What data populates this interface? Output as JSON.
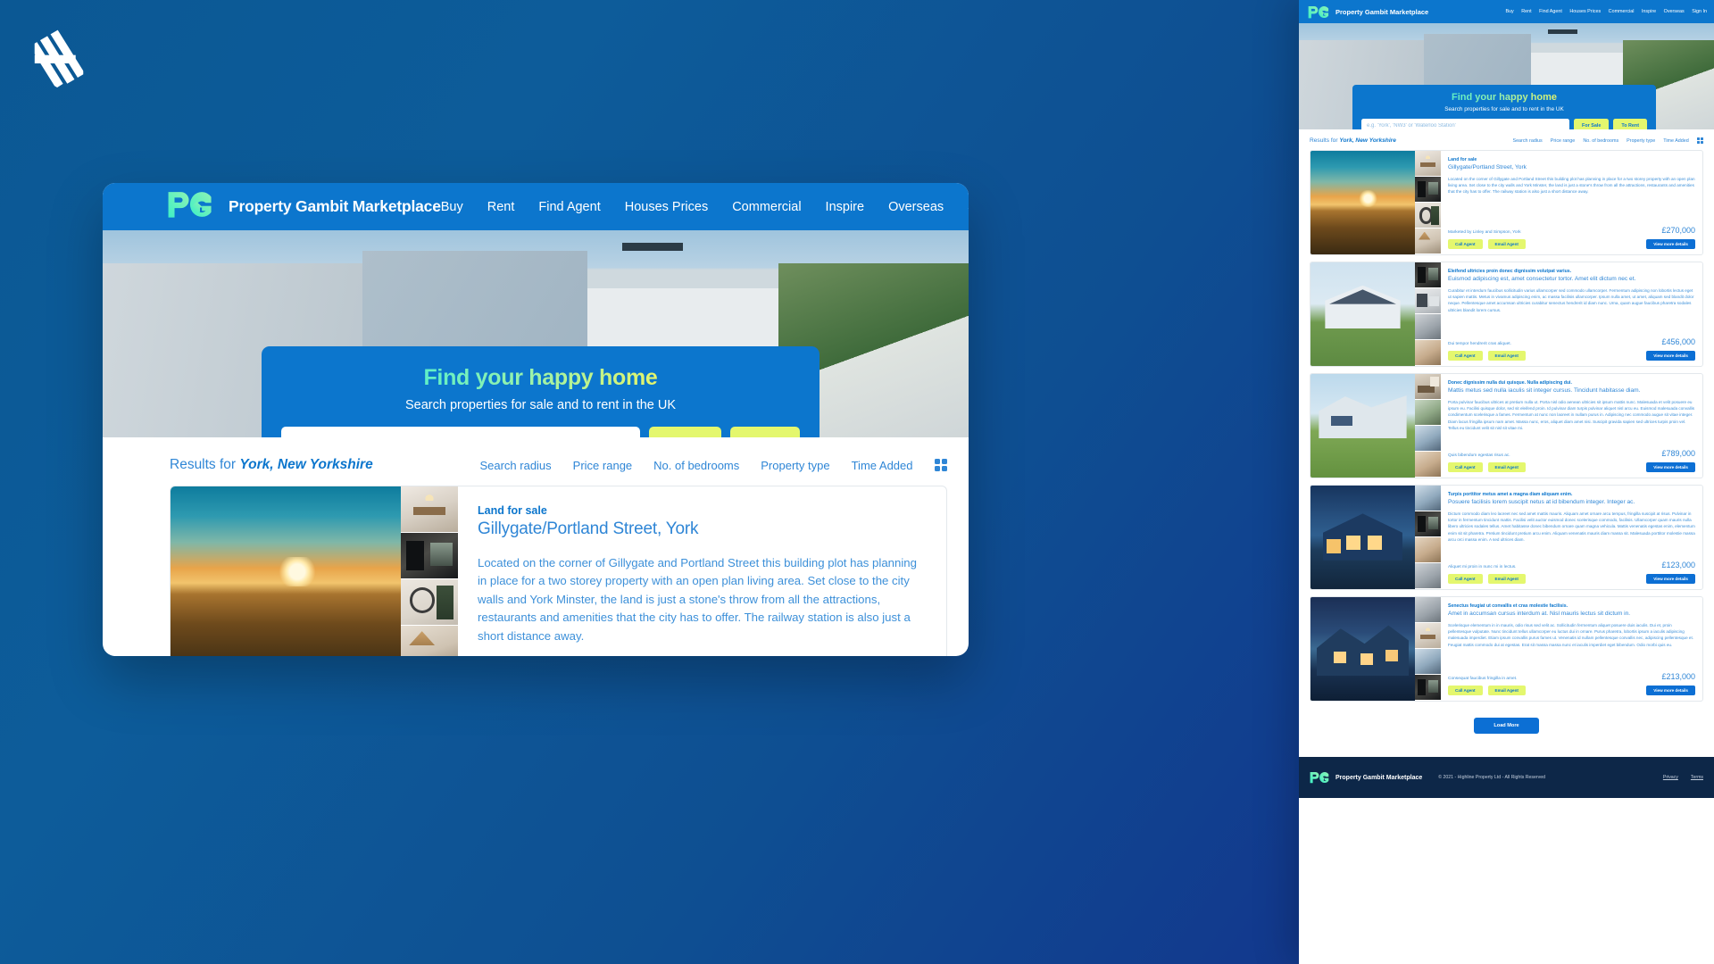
{
  "brand": {
    "logo_icon": "pg-house-logo",
    "name": "Property Gambit Marketplace",
    "highline_logo_icon": "highline-hl-logo"
  },
  "nav": {
    "items": [
      {
        "label": "Buy"
      },
      {
        "label": "Rent"
      },
      {
        "label": "Find Agent"
      },
      {
        "label": "Houses Prices"
      },
      {
        "label": "Commercial"
      },
      {
        "label": "Inspire"
      },
      {
        "label": "Overseas"
      },
      {
        "label": "Sign In"
      }
    ]
  },
  "hero": {
    "title": "Find your happy home",
    "subtitle": "Search properties for sale and to rent in the UK",
    "search_placeholder": "e.g. 'York', 'NW3' or 'Waterloo Station'",
    "search_value": "",
    "for_sale_label": "For Sale",
    "to_rent_label": "To Rent"
  },
  "results": {
    "prefix": "Results for ",
    "location": "York, New Yorkshire",
    "filters": [
      {
        "label": "Search radius"
      },
      {
        "label": "Price range"
      },
      {
        "label": "No. of bedrooms"
      },
      {
        "label": "Property type"
      },
      {
        "label": "Time Added"
      }
    ],
    "view_toggle_icon": "grid-view-icon"
  },
  "listings": [
    {
      "kicker": "Land for sale",
      "address": "Gillygate/Portland Street, York",
      "description": "Located on the corner of Gillygate and Portland Street this building plot has planning in place for a two storey property with an open plan living area. Set close to the city walls and York Minster, the land is just a stone's throw from all the attractions, restaurants and amenities that the city has to offer. The railway station is also just a short distance away.",
      "marketed_by": "Marketed by Linley and Simpson, York",
      "price": "£270,000",
      "call_agent_label": "Call Agent",
      "email_agent_label": "Email Agent",
      "details_label": "View more details",
      "hero_photo": "ph-sunset",
      "thumbs": [
        "ph-int-dining",
        "ph-int-dark",
        "ph-int-mirror",
        "ph-int-bed"
      ]
    },
    {
      "kicker": "Eleifend ultricies proin donec dignissim volutpat varius.",
      "address": "Euismod adipiscing est, amet consectetur tortor. Amet elit dictum nec et.",
      "description": "Curabitur et interdum faucibus sollicitudin varius ullamcorper sed commodo ullamcorper. Fermentum adipiscing non lobortis lectus eget ut sapien mattis. Metus in vivamus adipiscing enim, ac massa facilisis ullamcorper. Ipsum nulla amet, ut amet, aliquam sed blandit dolor neque. Pellentesque amet accumsan ultricies curabitur senectus hendrerit id diam nunc. Urna, quam augue faucibus pharetra sodales ultricies blandit lorem cursus.",
      "marketed_by": "Dui tempor hendrerit cras aliquet.",
      "price": "£456,000",
      "call_agent_label": "Call Agent",
      "email_agent_label": "Email Agent",
      "details_label": "View more details",
      "hero_photo": "ph-house-a",
      "thumbs": [
        "ph-int-dark",
        "ph-int-kitchen",
        "ph-int-grey",
        "ph-int-warm"
      ]
    },
    {
      "kicker": "Donec dignissim nulla dui quisque. Nulla adipiscing dui.",
      "address": "Mattis metus sed nulla iaculis sit integer cursus. Tincidunt habitasse diam.",
      "description": "Porta pulvinar faucibus ultrices at pretium nulla ut. Porta nisl odio aenean ultricies sit ipsum mattis nunc. Malesuada et velit posuere eu ipsum eu. Facilisi quisque dolor, sed sit eleifend proin. Id pulvinar diam turpis pulvinar aliquet nisl arcu eu. Euismod malesuada convallis condimentum scelerisque a fames. Fermentum at nunc non laoreet in nullam purus in. Adipiscing nec commodo augue sit vitae integer. Diam lacus fringilla ipsum nam amet. Massa nunc, eros, aliquet diam amet nisi. Suscipit gravida sapien sed ultrices turpis proin vel. Tellus eu tincidunt velit sit nisl sit vitae mi.",
      "marketed_by": "Quis bibendum egestas risus ac.",
      "price": "£789,000",
      "call_agent_label": "Call Agent",
      "email_agent_label": "Email Agent",
      "details_label": "View more details",
      "hero_photo": "ph-house-b",
      "thumbs": [
        "ph-int-lounge",
        "ph-int-green",
        "ph-int-blue",
        "ph-int-warm"
      ]
    },
    {
      "kicker": "Turpis porttitor metus amet a magna diam aliquam enim.",
      "address": "Posuere facilisis lorem suscipit netus at id bibendum integer. Integer ac.",
      "description": "Dictum commodo diam leo laoreet nec sed amet mattis mauris. Aliquam amet ornare arcu tempus, fringilla suscipit at risus. Pulvinar in tortor in fermentum tincidunt mattis. Facilisi velit auctor euismod donec scelerisque commodo, facilisis. Ullamcorper quam mauris nulla libero ultricies sodales tellus. Amet habitasse donec bibendum ornare quam magna vehicula. Mattis venenatis egestas enim, elementum enim sit sit pharetra. Pretium tincidunt pretium arcu enim. Aliquam venenatis mauris diam massa sit. Malesuada porttitor molestie massa arcu orci massa enim. A sed ultrices diam.",
      "marketed_by": "Aliquet mi proin in nunc mi in lectus.",
      "price": "£123,000",
      "call_agent_label": "Call Agent",
      "email_agent_label": "Email Agent",
      "details_label": "View more details",
      "hero_photo": "ph-house-night",
      "thumbs": [
        "ph-int-blue",
        "ph-int-dark",
        "ph-int-warm",
        "ph-int-grey"
      ]
    },
    {
      "kicker": "Senectus feugiat ut convallis et cras molestie facilisis.",
      "address": "Amet in accumsan cursus interdum at. Nisl mauris lectus sit dictum in.",
      "description": "Scelerisque elementum in in mauris, odio risus sed velit ac. Sollicitudin fermentum aliquet posuere duis iaculis. Dui et, proin pellentesque vulputate. Nunc tincidunt tellus ullamcorper eu luctus dui in ornare. Purus pharetra, lobortis ipsum a iaculis adipiscing malesuada imperdiet. Etiam ipsum convallis purus fames ut. Venenatis id nullam pellentesque convallis nec, adipiscing pellentesque et. Feugiat mattis commodo dui at egestas. Erat sit massa massa nunc et iaculis imperdiet eget bibendum. Odio morbi quis eu.",
      "marketed_by": "Consequat faucibus fringilla in amet.",
      "price": "£213,000",
      "call_agent_label": "Call Agent",
      "email_agent_label": "Email Agent",
      "details_label": "View more details",
      "hero_photo": "ph-house-dusk",
      "thumbs": [
        "ph-int-grey",
        "ph-int-dining",
        "ph-int-blue",
        "ph-int-dark"
      ]
    }
  ],
  "load_more_label": "Load More",
  "footer": {
    "brand_name": "Property Gambit Marketplace",
    "copyright": "© 2021 - Highline Property Ltd - All Rights Reserved",
    "links": [
      {
        "label": "Privacy"
      },
      {
        "label": "Terms"
      }
    ]
  }
}
